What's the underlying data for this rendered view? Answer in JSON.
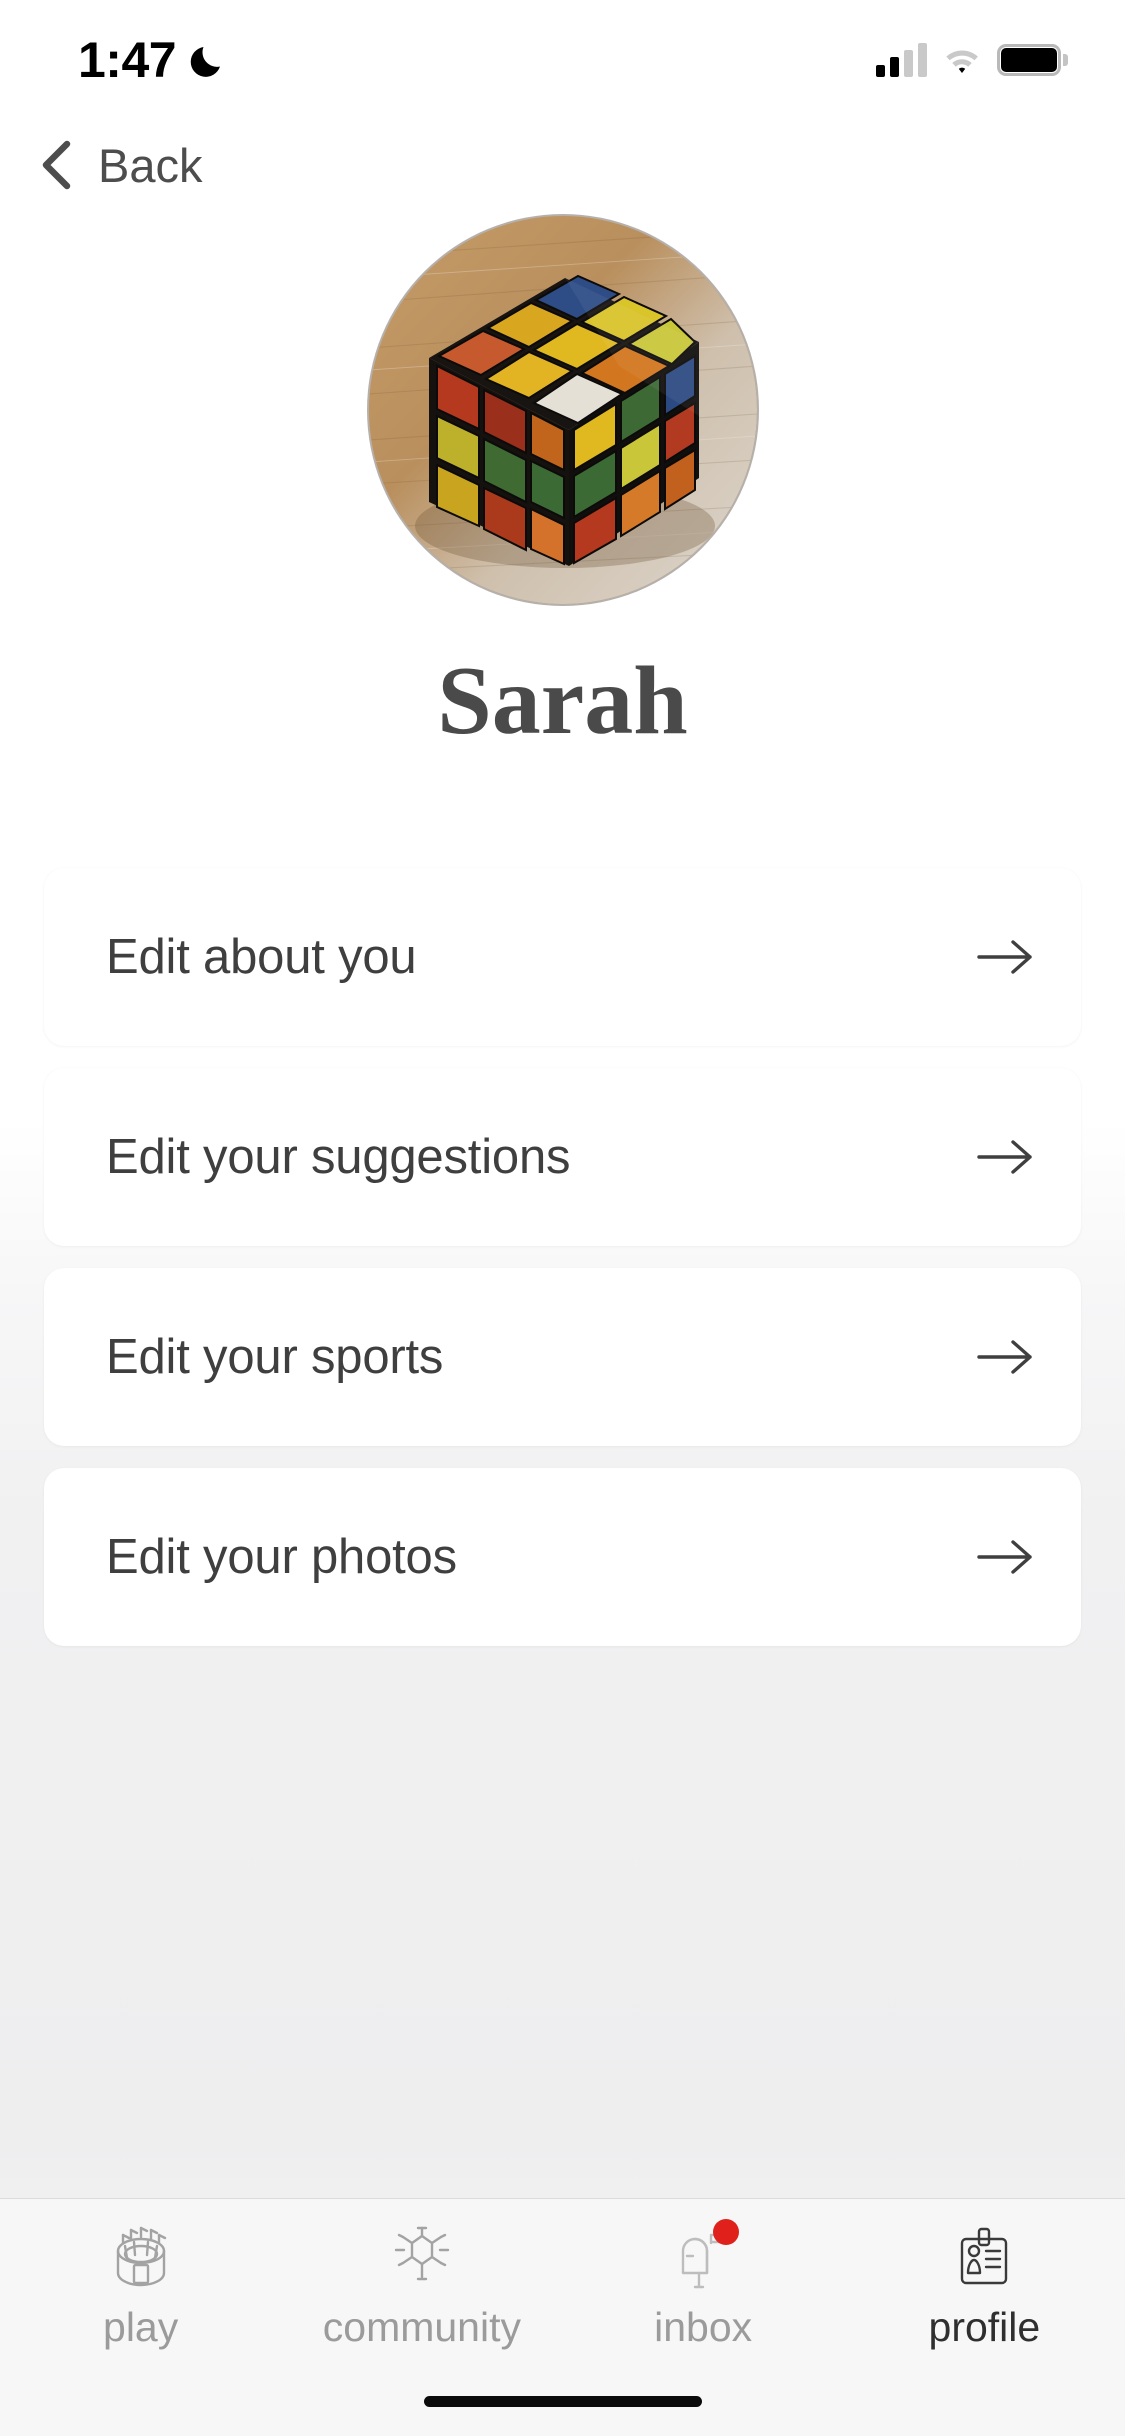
{
  "status_bar": {
    "time": "1:47",
    "dnd_icon": "moon-icon",
    "signal_icon": "cellular-signal-icon",
    "wifi_icon": "wifi-icon",
    "battery_icon": "battery-icon"
  },
  "nav": {
    "back_label": "Back",
    "back_icon": "chevron-left-icon"
  },
  "profile": {
    "name": "Sarah",
    "avatar_alt": "rubiks-cube-photo"
  },
  "cards": [
    {
      "label": "Edit about you",
      "arrow_icon": "arrow-right-icon"
    },
    {
      "label": "Edit your suggestions",
      "arrow_icon": "arrow-right-icon"
    },
    {
      "label": "Edit your sports",
      "arrow_icon": "arrow-right-icon"
    },
    {
      "label": "Edit your photos",
      "arrow_icon": "arrow-right-icon"
    }
  ],
  "tabbar": {
    "items": [
      {
        "label": "play",
        "icon": "stadium-icon",
        "active": false,
        "badge": false
      },
      {
        "label": "community",
        "icon": "network-icon",
        "active": false,
        "badge": false
      },
      {
        "label": "inbox",
        "icon": "mailbox-icon",
        "active": false,
        "badge": true
      },
      {
        "label": "profile",
        "icon": "id-card-icon",
        "active": true,
        "badge": false
      }
    ]
  },
  "colors": {
    "badge_red": "#e0211b",
    "text_primary": "#3f3f3f",
    "text_muted": "#9b9b9b",
    "card_bg": "#ffffff",
    "page_bg": "#f1f1f2"
  }
}
